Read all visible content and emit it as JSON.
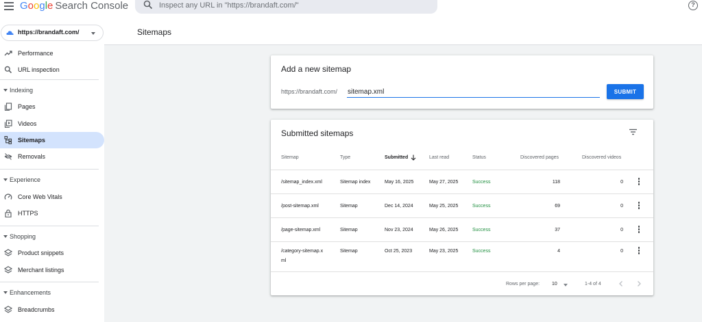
{
  "app": {
    "logo_google": [
      "G",
      "o",
      "o",
      "g",
      "l",
      "e"
    ],
    "product_name": "Search Console",
    "search_placeholder": "Inspect any URL in \"https://brandaft.com/\"",
    "help_icon": "?"
  },
  "sidebar": {
    "property": "https://brandaft.com/",
    "items": [
      {
        "label": "Performance",
        "icon": "trending-up-icon"
      },
      {
        "label": "URL inspection",
        "icon": "search-icon"
      }
    ],
    "sections": [
      {
        "label": "Indexing",
        "items": [
          {
            "label": "Pages",
            "icon": "pages-icon"
          },
          {
            "label": "Videos",
            "icon": "video-icon"
          },
          {
            "label": "Sitemaps",
            "icon": "sitemap-icon",
            "active": true
          },
          {
            "label": "Removals",
            "icon": "eye-off-icon"
          }
        ]
      },
      {
        "label": "Experience",
        "items": [
          {
            "label": "Core Web Vitals",
            "icon": "gauge-icon"
          },
          {
            "label": "HTTPS",
            "icon": "lock-icon"
          }
        ]
      },
      {
        "label": "Shopping",
        "items": [
          {
            "label": "Product snippets",
            "icon": "layers-icon"
          },
          {
            "label": "Merchant listings",
            "icon": "layers-icon"
          }
        ]
      },
      {
        "label": "Enhancements",
        "items": [
          {
            "label": "Breadcrumbs",
            "icon": "layers-icon"
          }
        ]
      }
    ]
  },
  "main": {
    "page_title": "Sitemaps",
    "add_card": {
      "title": "Add a new sitemap",
      "prefix": "https://brandaft.com/",
      "input_value": "sitemap.xml",
      "submit_label": "SUBMIT"
    },
    "submitted_card": {
      "title": "Submitted sitemaps",
      "columns": [
        "Sitemap",
        "Type",
        "Submitted",
        "Last read",
        "Status",
        "Discovered pages",
        "Discovered videos"
      ],
      "rows": [
        {
          "sitemap": "/sitemap_index.xml",
          "type": "Sitemap index",
          "submitted": "May 16, 2025",
          "last_read": "May 27, 2025",
          "status": "Success",
          "pages": "118",
          "videos": "0"
        },
        {
          "sitemap": "/post-sitemap.xml",
          "type": "Sitemap",
          "submitted": "Dec 14, 2024",
          "last_read": "May 25, 2025",
          "status": "Success",
          "pages": "69",
          "videos": "0"
        },
        {
          "sitemap": "/page-sitemap.xml",
          "type": "Sitemap",
          "submitted": "Nov 23, 2024",
          "last_read": "May 26, 2025",
          "status": "Success",
          "pages": "37",
          "videos": "0"
        },
        {
          "sitemap_line1": "/category-sitemap.x",
          "sitemap_line2": "ml",
          "type": "Sitemap",
          "submitted": "Oct 25, 2023",
          "last_read": "May 23, 2025",
          "status": "Success",
          "pages": "4",
          "videos": "0"
        }
      ],
      "footer": {
        "rows_per_page_label": "Rows per page:",
        "rows_per_page_value": "10",
        "range": "1-4 of 4"
      }
    }
  },
  "colors": {
    "accent": "#1a73e8",
    "active_nav": "#d3e3fd",
    "success": "#1e8e3e",
    "background": "#f1f3f4"
  }
}
